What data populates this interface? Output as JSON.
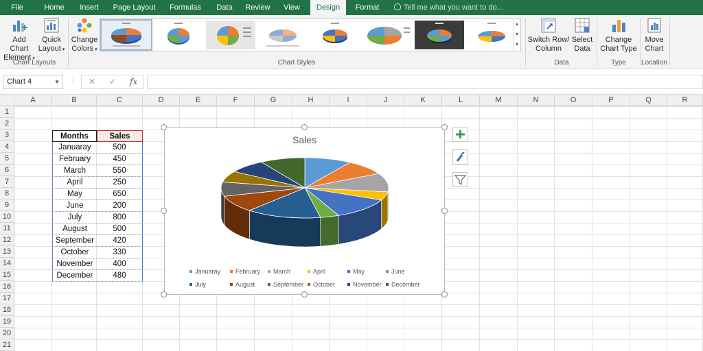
{
  "ribbon": {
    "tabs": [
      "File",
      "Home",
      "Insert",
      "Page Layout",
      "Formulas",
      "Data",
      "Review",
      "View",
      "Design",
      "Format"
    ],
    "active_tab": "Design",
    "tell_me": "Tell me what you want to do...",
    "buttons": {
      "add_chart_element": [
        "Add Chart",
        "Element"
      ],
      "quick_layout": [
        "Quick",
        "Layout"
      ],
      "change_colors": [
        "Change",
        "Colors"
      ],
      "switch_row_column": [
        "Switch Row/",
        "Column"
      ],
      "select_data": [
        "Select",
        "Data"
      ],
      "change_chart_type": [
        "Change",
        "Chart Type"
      ],
      "move_chart": [
        "Move",
        "Chart"
      ]
    },
    "groups": {
      "chart_layouts": "Chart Layouts",
      "chart_styles": "Chart Styles",
      "data": "Data",
      "type": "Type",
      "location": "Location"
    }
  },
  "formula_bar": {
    "name_box": "Chart 4",
    "cancel_glyph": "✕",
    "enter_glyph": "✓",
    "fx_glyph": "fx",
    "content": ""
  },
  "grid": {
    "columns": [
      "A",
      "B",
      "C",
      "D",
      "E",
      "F",
      "G",
      "H",
      "I",
      "J",
      "K",
      "L",
      "M",
      "N",
      "O",
      "P",
      "Q",
      "R"
    ],
    "rows": [
      "1",
      "2",
      "3",
      "4",
      "5",
      "6",
      "7",
      "8",
      "9",
      "10",
      "11",
      "12",
      "13",
      "14",
      "15",
      "16",
      "17",
      "18",
      "19",
      "20",
      "21"
    ]
  },
  "table": {
    "header": [
      "Months",
      "Sales"
    ],
    "rows": [
      [
        "Januaray",
        "500"
      ],
      [
        "February",
        "450"
      ],
      [
        "March",
        "550"
      ],
      [
        "April",
        "250"
      ],
      [
        "May",
        "650"
      ],
      [
        "June",
        "200"
      ],
      [
        "July",
        "800"
      ],
      [
        "August",
        "500"
      ],
      [
        "September",
        "420"
      ],
      [
        "October",
        "330"
      ],
      [
        "November",
        "400"
      ],
      [
        "December",
        "480"
      ]
    ]
  },
  "chart_data": {
    "type": "pie",
    "title": "Sales",
    "categories": [
      "Januaray",
      "February",
      "March",
      "April",
      "May",
      "June",
      "July",
      "August",
      "September",
      "October",
      "November",
      "December"
    ],
    "values": [
      500,
      450,
      550,
      250,
      650,
      200,
      800,
      500,
      420,
      330,
      400,
      480
    ],
    "colors": [
      "#5b9bd5",
      "#ed7d31",
      "#a5a5a5",
      "#ffc000",
      "#4472c4",
      "#70ad47",
      "#255e91",
      "#9e480e",
      "#636363",
      "#997300",
      "#264478",
      "#43682b"
    ],
    "style": "3-D pie",
    "legend_position": "bottom"
  },
  "chart_tools": {
    "elements": "chart-elements-plus-icon",
    "styles": "chart-styles-brush-icon",
    "filters": "chart-filter-funnel-icon"
  }
}
